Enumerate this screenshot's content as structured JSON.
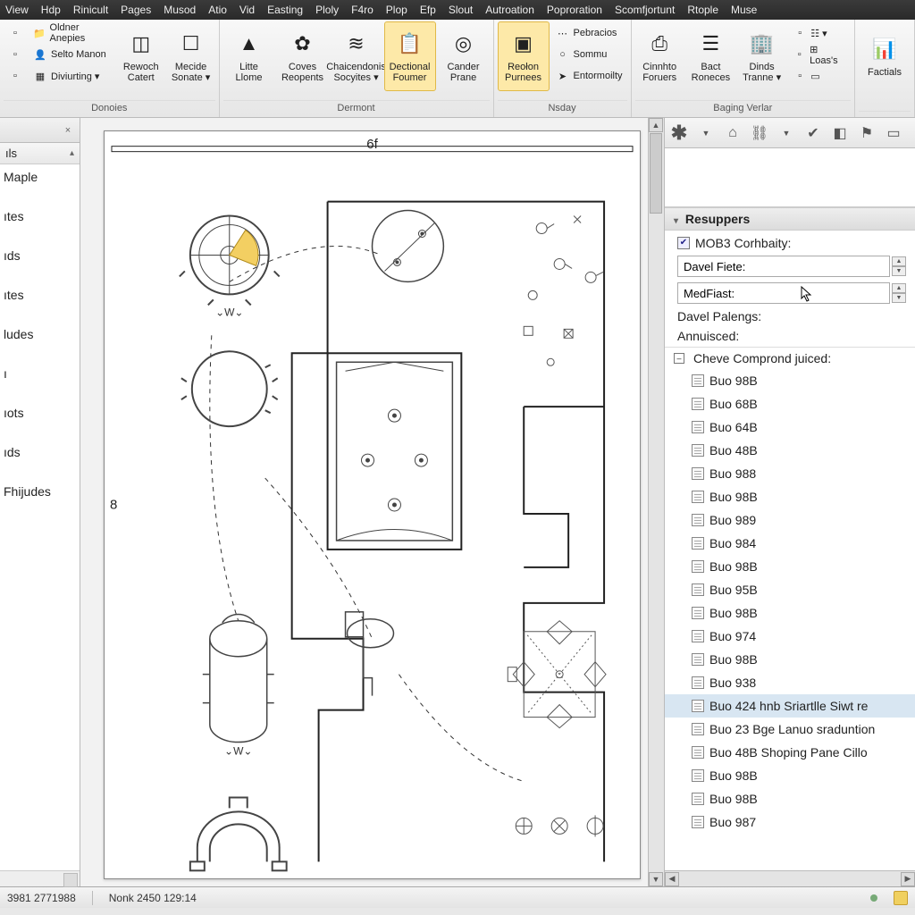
{
  "menubar": [
    "View",
    "Hdp",
    "Rinicult",
    "Pages",
    "Musod",
    "Atio",
    "Vid",
    "Easting",
    "Ploly",
    "F4ro",
    "Plop",
    "Efp",
    "Slout",
    "Autroation",
    "Poproration",
    "Scomfjortunt",
    "Rtople",
    "Muse"
  ],
  "ribbon": {
    "groups": [
      {
        "label": "Donoies",
        "side": [
          {
            "icon": "folder-icon",
            "label": "Oldner Anepies"
          },
          {
            "icon": "person-icon",
            "label": "Selto Manon"
          },
          {
            "icon": "grid-icon",
            "label": "Diviurting ▾"
          }
        ],
        "big": [
          {
            "icon": "cube-icon",
            "label": "Rewoch Catert"
          },
          {
            "icon": "window-icon",
            "label": "Mecide Sonate ▾"
          }
        ]
      },
      {
        "label": "Dermont",
        "big": [
          {
            "icon": "triangle-icon",
            "label": "Litte Llome"
          },
          {
            "icon": "gear-icon",
            "label": "Coves Reopents"
          },
          {
            "icon": "layers-icon",
            "label": "Chaicendonis Socyites ▾"
          },
          {
            "icon": "clipboard-icon",
            "label": "Dectional Foumer",
            "active": true
          },
          {
            "icon": "target-icon",
            "label": "Cander Prane"
          }
        ]
      },
      {
        "label": "Nsday",
        "big": [
          {
            "icon": "region-icon",
            "label": "Reołon Purnees",
            "active": true
          }
        ],
        "side": [
          {
            "icon": "dots-icon",
            "label": "Pebracios"
          },
          {
            "icon": "circle-icon",
            "label": "Sommu"
          },
          {
            "icon": "arrow-icon",
            "label": "Entormoilty"
          }
        ]
      },
      {
        "label": "Baging Verlar",
        "big": [
          {
            "icon": "printer-icon",
            "label": "Cinnhto Foruers"
          },
          {
            "icon": "stack-icon",
            "label": "Bact Roneces"
          },
          {
            "icon": "building-icon",
            "label": "Dinds Tranne ▾"
          }
        ],
        "side": [
          {
            "icon": "mini-icon",
            "label": "☷ ▾"
          },
          {
            "icon": "mini-icon",
            "label": "⊞ Loas's"
          },
          {
            "icon": "mini-icon",
            "label": "▭"
          }
        ]
      },
      {
        "label": "",
        "big": [
          {
            "icon": "chart-icon",
            "label": "Factials"
          }
        ]
      }
    ]
  },
  "left": {
    "tab": "ıls",
    "items": [
      "Maple",
      "ıtes",
      "ıds",
      "ıtes",
      "ludes",
      "ı",
      "ıots",
      "ıds",
      "Fhijudes"
    ]
  },
  "canvas": {
    "top_label": "6f",
    "left_label": "8"
  },
  "right": {
    "section": "Resuppers",
    "cat_label": "MOB3 Corhbaity:",
    "field1": "Davel Fiete:",
    "field2": "MedFiast:",
    "field3": "Davel Palengs:",
    "field4": "Annuisced:",
    "list_head": "Cheve Comprond juiced:",
    "items": [
      "Buo 98B",
      "Buo 68B",
      "Buo 64B",
      "Buo 48B",
      "Buo 988",
      "Buo 98B",
      "Buo 989",
      "Buo 984",
      "Buo 98B",
      "Buo 95B",
      "Buo 98B",
      "Buo 974",
      "Buo 98B",
      "Buo 938",
      "Buo 424 hnb Sriartlle Siwt re",
      "Buo 23 Bge Lanuo sraduntion",
      "Buo 48B Shoping Pane Cillo",
      "Buo 98B",
      "Buo 98B",
      "Buo 987"
    ],
    "selected_index": 14
  },
  "status": {
    "left1": "3981 2771988",
    "left2": "Nonk 2450 129:14"
  },
  "colors": {
    "highlight": "#fde9a8",
    "highlight_border": "#e0b947",
    "sel": "#d8e6f2"
  }
}
